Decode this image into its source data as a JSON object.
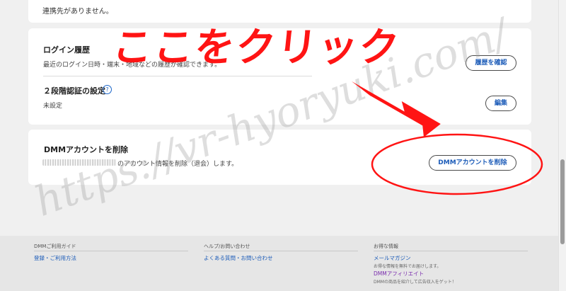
{
  "card1": {
    "text": "連携先がありません。"
  },
  "login_history": {
    "title": "ログイン履歴",
    "description": "最近のログイン日時・端末・地域などの履歴が確認できます。",
    "button_label": "履歴を確認"
  },
  "two_factor": {
    "title": "２段階認証の設定",
    "help_icon_glyph": "?",
    "status": "未設定",
    "button_label": "編集"
  },
  "delete_account": {
    "title": "DMMアカウントを削除",
    "description": "のアカウント情報を削除（退会）します。",
    "button_label": "DMMアカウントを削除"
  },
  "footer": {
    "col1": {
      "heading": "DMMご利用ガイド",
      "link": "登録・ご利用方法"
    },
    "col2": {
      "heading": "ヘルプ/お問い合わせ",
      "link": "よくある質問・お問い合わせ"
    },
    "col3": {
      "heading": "お得な情報",
      "link1": "メールマガジン",
      "link1_desc": "お得な情報を無料でお届けします。",
      "link2": "DMMアフィリエイト",
      "link2_desc": "DMMの商品を紹介して広告収入をゲット！"
    }
  },
  "annotation": {
    "text": "ここをクリック"
  },
  "watermark": {
    "text": "https://vr-hyoryuki.com/"
  },
  "colors": {
    "annotation_red": "#ff1414",
    "link_blue": "#1b5bb8",
    "affiliate_purple": "#7a2cae",
    "background": "#f0f0f0"
  }
}
